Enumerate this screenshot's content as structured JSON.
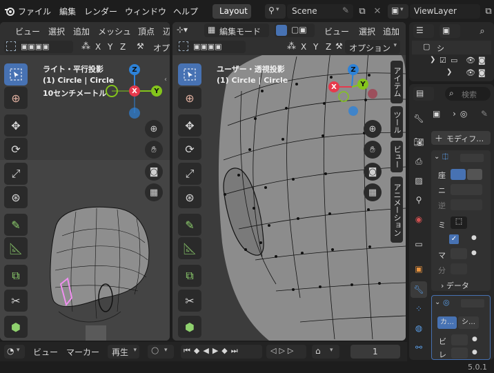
{
  "topbar": {
    "menus": [
      "ファイル",
      "編集",
      "レンダー",
      "ウィンドウ",
      "ヘルプ"
    ],
    "workspace_tab": "Layout",
    "scene_name": "Scene",
    "view_layer": "ViewLayer"
  },
  "left_view": {
    "header_menus": [
      "ビュー",
      "選択",
      "追加",
      "メッシュ",
      "頂点",
      "辺"
    ],
    "axes": [
      "X",
      "Y",
      "Z"
    ],
    "options_label": "オプ",
    "overlay_lines": [
      "ライト・平行投影",
      "(1) Circle | Circle",
      "10センチメートル"
    ]
  },
  "right_view": {
    "mode_label": "編集モード",
    "header_menus": [
      "ビュー",
      "選択",
      "追加"
    ],
    "axes": [
      "X",
      "Y",
      "Z"
    ],
    "options_label": "オプション",
    "overlay_lines": [
      "ユーザー・透視投影",
      "(1) Circle | Circle"
    ],
    "side_tabs": [
      "アイテム",
      "ツール",
      "ビュー",
      "アニメーション"
    ]
  },
  "gizmo_labels": {
    "x": "X",
    "y": "Y",
    "z": "Z"
  },
  "timeline": {
    "menus": [
      "ビュー",
      "マーカー"
    ],
    "playback_label": "再生",
    "current_frame": "1"
  },
  "outliner": {
    "rows": [
      "シ",
      ""
    ]
  },
  "properties": {
    "search_placeholder": "検索",
    "add_modifier_label": "モディフ…",
    "labels": [
      "座",
      "ニ",
      "逆",
      "ミ",
      "マ",
      "分"
    ],
    "data_label": "データ",
    "mod2_buttons": [
      "カ…",
      "シ…"
    ],
    "mod2_labels": [
      "ビ",
      "レ"
    ]
  },
  "status": {
    "version": "5.0.1"
  },
  "colors": {
    "accent": "#4772b3",
    "x_axis": "#e6394c",
    "y_axis": "#84c51c",
    "z_axis": "#2d82d8",
    "mesh_selected": "#f08ff0"
  }
}
